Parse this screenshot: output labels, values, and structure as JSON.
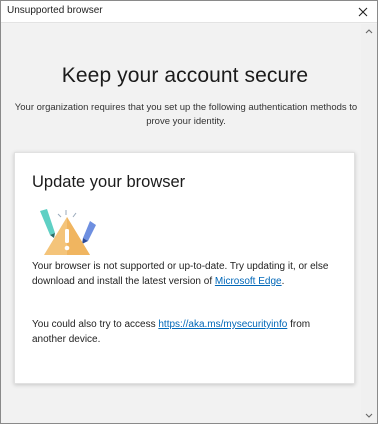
{
  "window": {
    "title": "Unsupported browser"
  },
  "page": {
    "heading": "Keep your account secure",
    "subtext": "Your organization requires that you set up the following authentication methods to prove your identity."
  },
  "card": {
    "title": "Update your browser",
    "p1_text": "Your browser is not supported or up-to-date. Try updating it, or else download and install the latest version of ",
    "p1_link": "Microsoft Edge",
    "p1_end": ".",
    "p2_text": "You could also try to access ",
    "p2_link": "https://aka.ms/mysecurityinfo",
    "p2_end": " from another device."
  },
  "colors": {
    "link": "#0067b8",
    "warning": "#f4c47a"
  },
  "icons": {
    "close": "close-icon",
    "illustration": "warning-triangle-icon"
  }
}
